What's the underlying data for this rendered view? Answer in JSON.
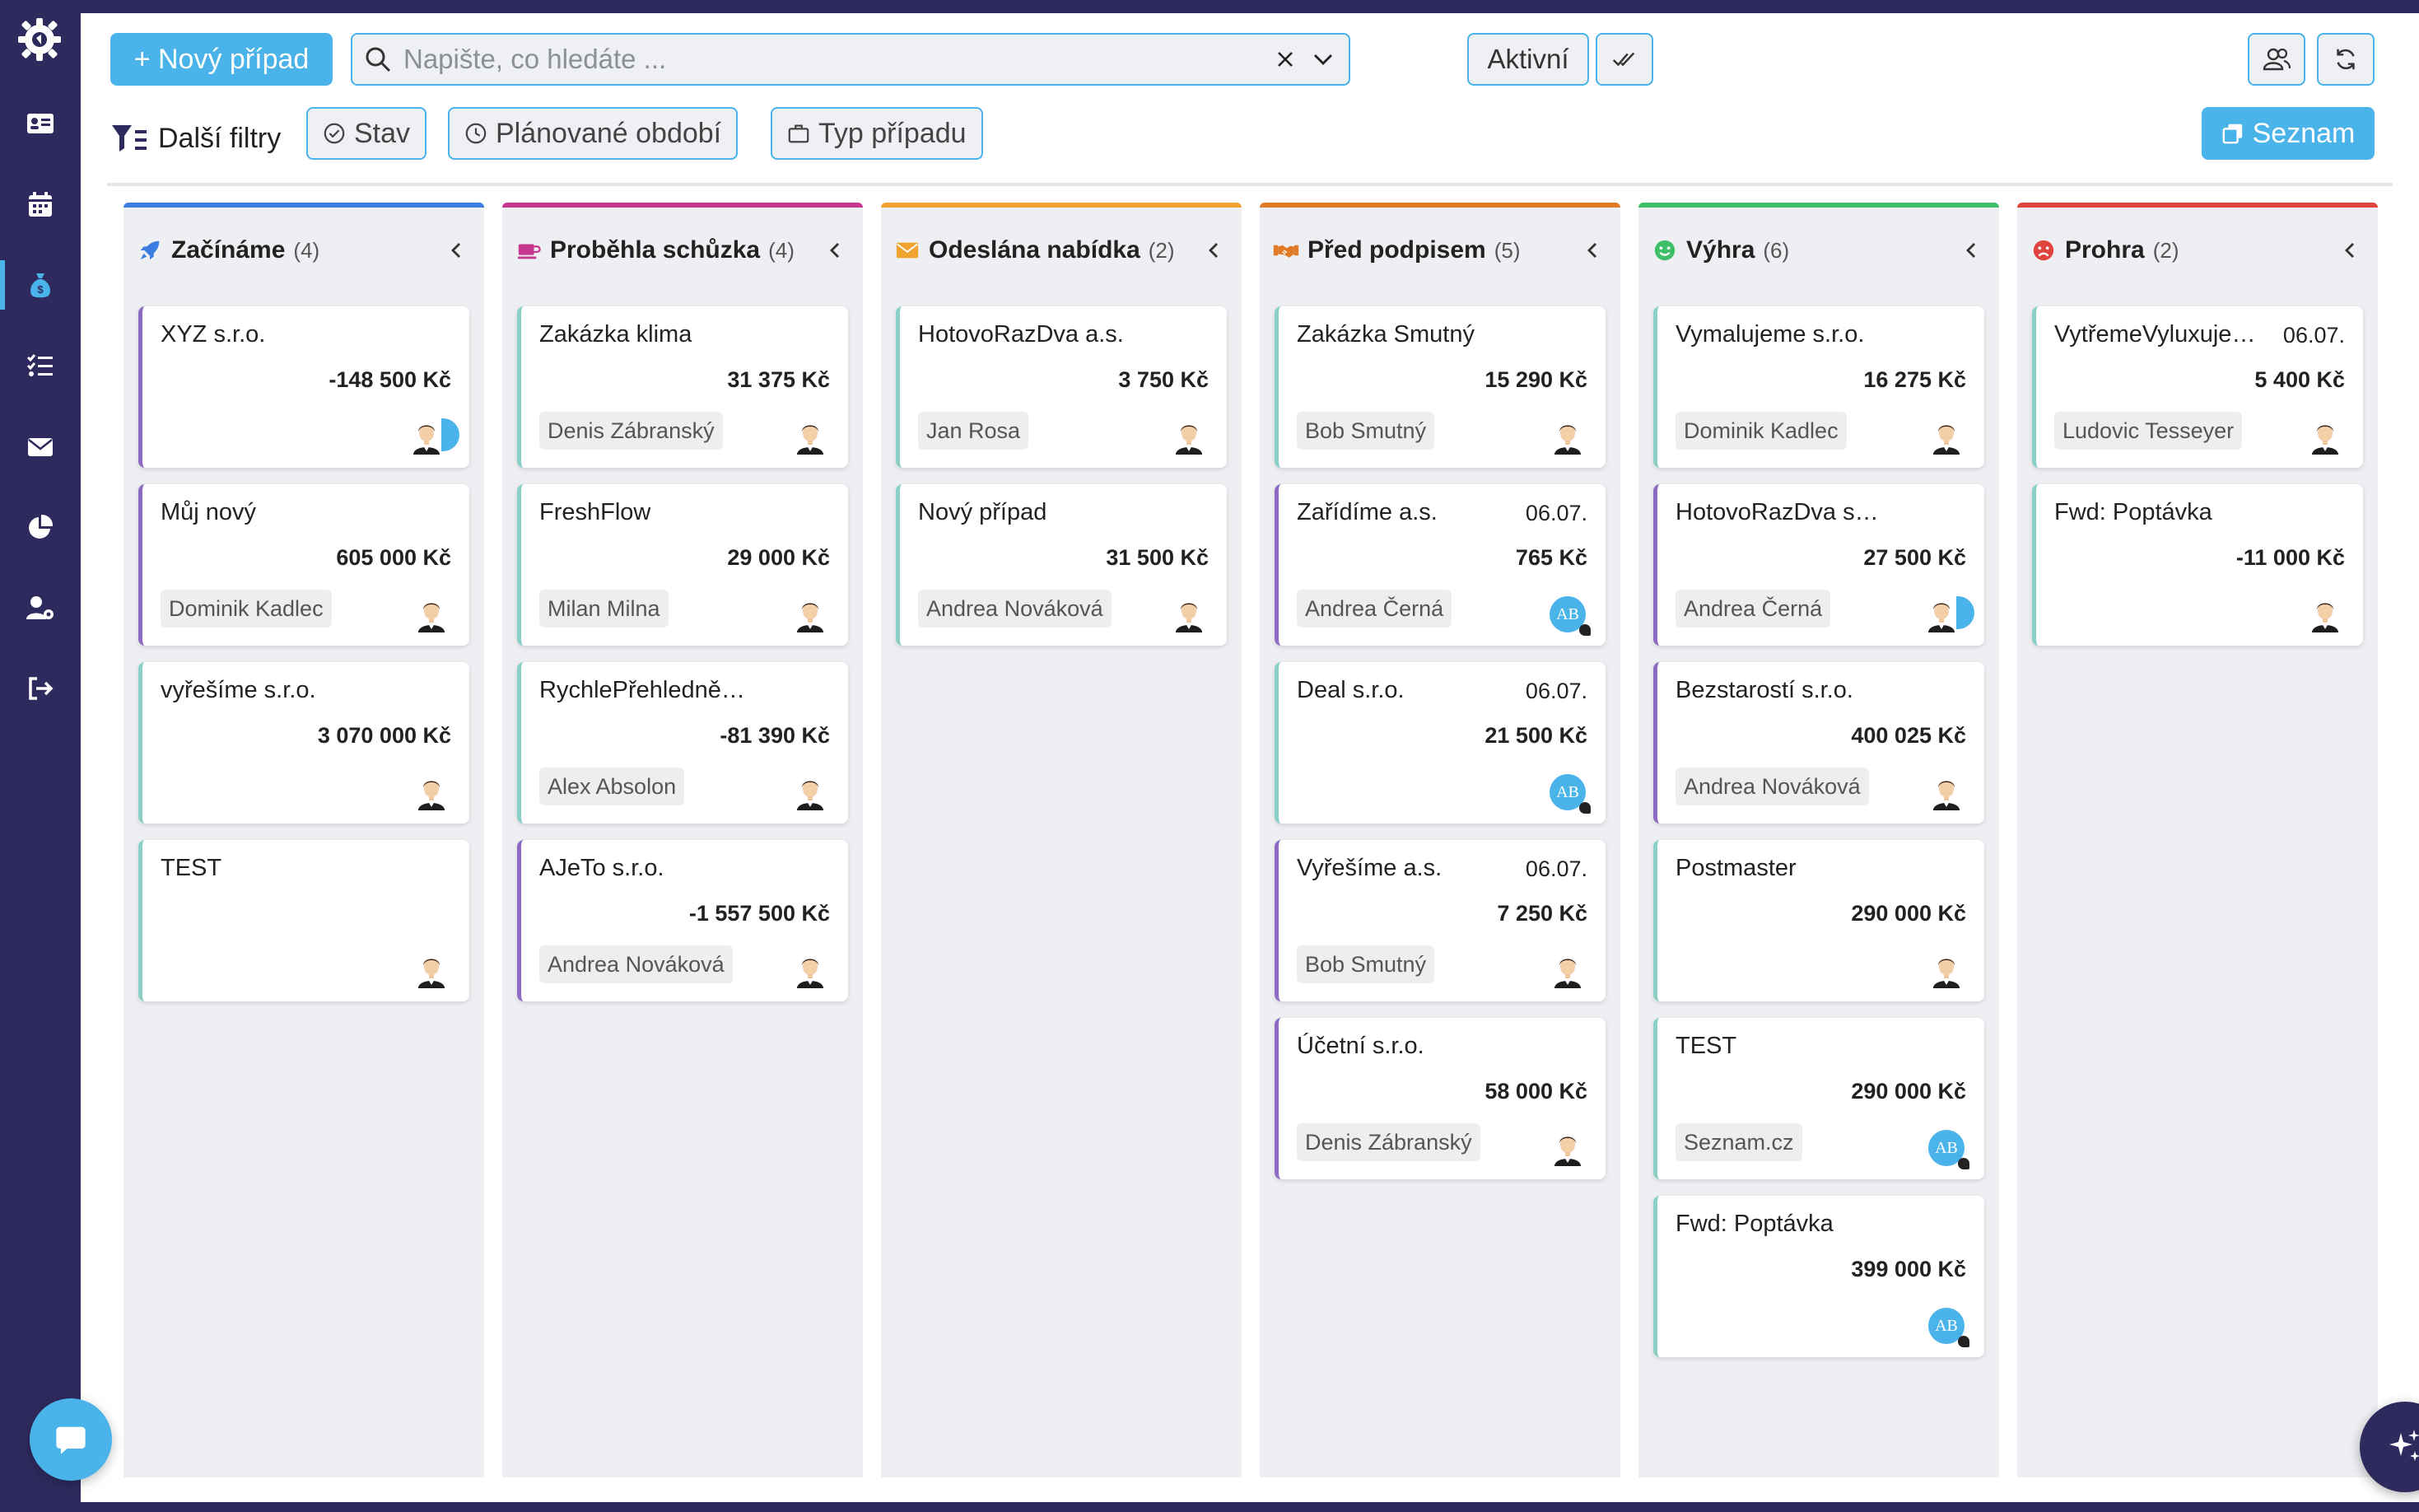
{
  "sidebar": {
    "items": [
      {
        "name": "contacts-icon"
      },
      {
        "name": "calendar-icon"
      },
      {
        "name": "money-bag-icon",
        "active": true
      },
      {
        "name": "tasks-icon"
      },
      {
        "name": "mail-icon"
      },
      {
        "name": "pie-chart-icon"
      },
      {
        "name": "user-settings-icon"
      },
      {
        "name": "logout-icon"
      }
    ]
  },
  "toolbar": {
    "new_case_label": "+ Nový případ",
    "search_placeholder": "Napište, co hledáte ...",
    "active_label": "Aktivní",
    "more_filters_label": "Další filtry",
    "filter_state_label": "Stav",
    "filter_period_label": "Plánované období",
    "filter_type_label": "Typ případu",
    "list_view_label": "Seznam"
  },
  "colors": {
    "accent": "#4ab3ea",
    "sidebar": "#2e2a5e"
  },
  "columns": [
    {
      "title": "Začínáme",
      "count": "(4)",
      "color": "#3b7de0",
      "icon": "rocket-icon",
      "cards": [
        {
          "name": "XYZ s.r.o.",
          "date": "",
          "amount": "-148 500 Kč",
          "person": "",
          "accent": "purple",
          "avatar": "person+half"
        },
        {
          "name": "Můj nový",
          "date": "",
          "amount": "605 000 Kč",
          "person": "Dominik Kadlec",
          "accent": "purple",
          "avatar": "person"
        },
        {
          "name": "vyřešíme s.r.o.",
          "date": "",
          "amount": "3 070 000 Kč",
          "person": "",
          "accent": "teal",
          "avatar": "person"
        },
        {
          "name": "TEST",
          "date": "",
          "amount": "",
          "person": "",
          "accent": "teal",
          "avatar": "person"
        }
      ]
    },
    {
      "title": "Proběhla schůzka",
      "count": "(4)",
      "color": "#c8378f",
      "icon": "coffee-icon",
      "cards": [
        {
          "name": "Zakázka klima",
          "date": "",
          "amount": "31 375 Kč",
          "person": "Denis Zábranský",
          "accent": "teal",
          "avatar": "person"
        },
        {
          "name": "FreshFlow",
          "date": "",
          "amount": "29 000 Kč",
          "person": "Milan Milna",
          "accent": "teal",
          "avatar": "person"
        },
        {
          "name": "RychlePřehledně a....",
          "date": "",
          "amount": "-81 390 Kč",
          "person": "Alex Absolon",
          "accent": "teal",
          "avatar": "person"
        },
        {
          "name": "AJeTo s.r.o.",
          "date": "",
          "amount": "-1 557 500 Kč",
          "person": "Andrea Nováková",
          "accent": "purple",
          "avatar": "person"
        }
      ]
    },
    {
      "title": "Odeslána nabídka",
      "count": "(2)",
      "color": "#f0a330",
      "icon": "envelope-icon",
      "cards": [
        {
          "name": "HotovoRazDva a.s.",
          "date": "",
          "amount": "3 750 Kč",
          "person": "Jan Rosa",
          "accent": "teal",
          "avatar": "person"
        },
        {
          "name": "Nový případ",
          "date": "",
          "amount": "31 500 Kč",
          "person": "Andrea Nováková",
          "accent": "teal",
          "avatar": "person"
        }
      ]
    },
    {
      "title": "Před podpisem",
      "count": "(5)",
      "color": "#e07a27",
      "icon": "handshake-icon",
      "cards": [
        {
          "name": "Zakázka Smutný",
          "date": "",
          "amount": "15 290 Kč",
          "person": "Bob Smutný",
          "accent": "teal",
          "avatar": "person"
        },
        {
          "name": "Zařídíme a.s.",
          "date": "06.07.",
          "amount": "765 Kč",
          "person": "Andrea Černá",
          "accent": "purple",
          "avatar": "AB"
        },
        {
          "name": "Deal s.r.o.",
          "date": "06.07.",
          "amount": "21 500 Kč",
          "person": "",
          "accent": "teal",
          "avatar": "AB"
        },
        {
          "name": "Vyřešíme a.s.",
          "date": "06.07.",
          "amount": "7 250 Kč",
          "person": "Bob Smutný",
          "accent": "purple",
          "avatar": "person"
        },
        {
          "name": "Účetní s.r.o.",
          "date": "",
          "amount": "58 000 Kč",
          "person": "Denis Zábranský",
          "accent": "purple",
          "avatar": "person"
        }
      ]
    },
    {
      "title": "Výhra",
      "count": "(6)",
      "color": "#3fbf6a",
      "icon": "smile-icon",
      "cards": [
        {
          "name": "Vymalujeme s.r.o.",
          "date": "",
          "amount": "16 275 Kč",
          "person": "Dominik Kadlec",
          "accent": "teal",
          "avatar": "person"
        },
        {
          "name": "HotovoRazDva s.r.o.",
          "date": "",
          "amount": "27 500 Kč",
          "person": "Andrea Černá",
          "accent": "purple",
          "avatar": "person+half"
        },
        {
          "name": "Bezstarostí s.r.o.",
          "date": "",
          "amount": "400 025 Kč",
          "person": "Andrea Nováková",
          "accent": "purple",
          "avatar": "person"
        },
        {
          "name": "Postmaster",
          "date": "",
          "amount": "290 000 Kč",
          "person": "",
          "accent": "teal",
          "avatar": "person"
        },
        {
          "name": "TEST",
          "date": "",
          "amount": "290 000 Kč",
          "person": "Seznam.cz",
          "accent": "teal",
          "avatar": "AB"
        },
        {
          "name": "Fwd: Poptávka",
          "date": "",
          "amount": "399 000 Kč",
          "person": "",
          "accent": "teal",
          "avatar": "AB"
        }
      ]
    },
    {
      "title": "Prohra",
      "count": "(2)",
      "color": "#e0443e",
      "icon": "frown-icon",
      "cards": [
        {
          "name": "VytřemeVyluxujem...",
          "date": "06.07.",
          "amount": "5 400 Kč",
          "person": "Ludovic Tesseyer",
          "accent": "teal",
          "avatar": "person"
        },
        {
          "name": "Fwd: Poptávka",
          "date": "",
          "amount": "-11 000 Kč",
          "person": "",
          "accent": "teal",
          "avatar": "person"
        }
      ]
    }
  ],
  "avatar_initials": "AB"
}
